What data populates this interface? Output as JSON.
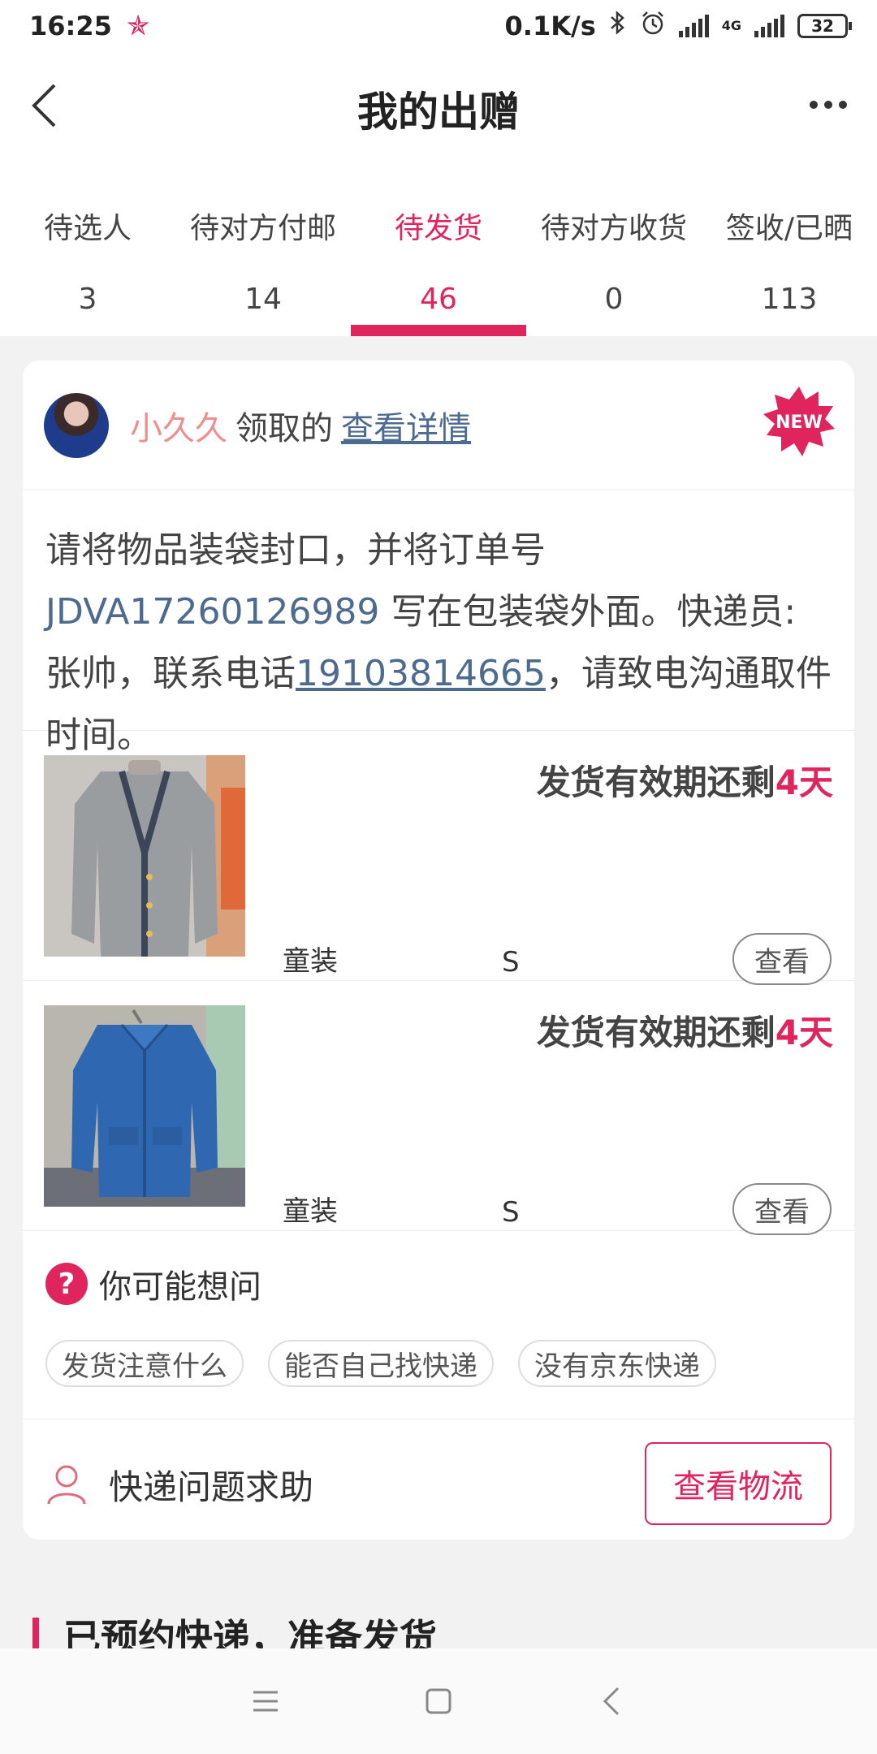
{
  "status_bar": {
    "time": "16:25",
    "network_speed": "0.1K/s",
    "network_type": "4G",
    "battery": "32"
  },
  "header": {
    "title": "我的出赠"
  },
  "tabs": [
    {
      "label": "待选人",
      "count": "3"
    },
    {
      "label": "待对方付邮",
      "count": "14"
    },
    {
      "label": "待发货",
      "count": "46",
      "active": true
    },
    {
      "label": "待对方收货",
      "count": "0"
    },
    {
      "label": "签收/已晒",
      "count": "113"
    }
  ],
  "card": {
    "user_name": "小久久",
    "received_text": "领取的",
    "detail_link": "查看详情",
    "badge": "NEW",
    "instructions": {
      "part1": "请将物品装袋封口，并将订单号 ",
      "order_no": "JDVA17260126989",
      "part2": " 写在包装袋外面。快递员:张帅，联系电话",
      "phone": "19103814665",
      "part3": "，请致电沟通取件时间。"
    },
    "items": [
      {
        "expire_prefix": "发货有效期还剩",
        "expire_days": "4天",
        "category": "童装",
        "size": "S",
        "view_label": "查看"
      },
      {
        "expire_prefix": "发货有效期还剩",
        "expire_days": "4天",
        "category": "童装",
        "size": "S",
        "view_label": "查看"
      }
    ],
    "faq": {
      "title": "你可能想问",
      "questions": [
        "发货注意什么",
        "能否自己找快递",
        "没有京东快递"
      ]
    },
    "help": {
      "label": "快递问题求助",
      "logistics_button": "查看物流"
    }
  },
  "next_section": {
    "title": "已预约快递，准备发货"
  },
  "colors": {
    "accent": "#e0245e",
    "link": "#4d6a8f",
    "username": "#ee8e8e"
  }
}
